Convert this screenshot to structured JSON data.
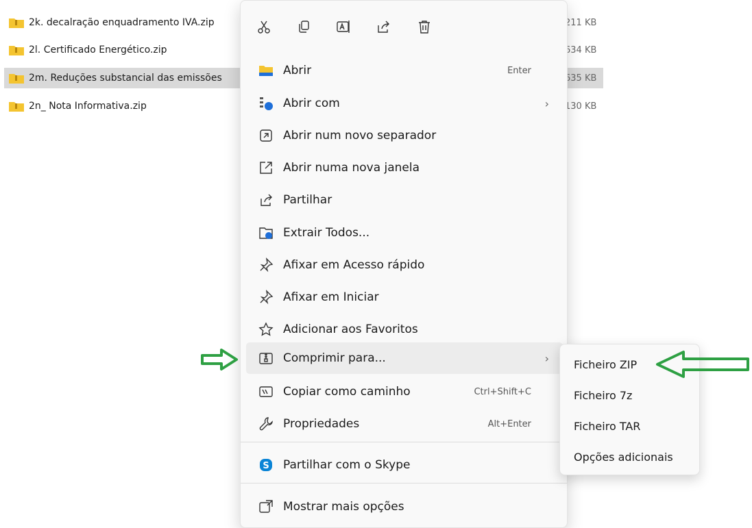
{
  "files": [
    {
      "name": "2k. decalração enquadramento IVA.zip",
      "size": "211 KB",
      "selected": false
    },
    {
      "name": "2l. Certificado Energético.zip",
      "size": "634 KB",
      "selected": false
    },
    {
      "name": "2m. Reduções  substancial das emissões",
      "size": "635 KB",
      "selected": true
    },
    {
      "name": "2n_ Nota Informativa.zip",
      "size": "130 KB",
      "selected": false
    }
  ],
  "context_menu": {
    "quick_actions": [
      "cut-icon",
      "copy-icon",
      "rename-icon",
      "share-icon",
      "delete-icon"
    ],
    "items": [
      {
        "label": "Abrir",
        "shortcut": "Enter",
        "icon": "folder-icon"
      },
      {
        "label": "Abrir com",
        "shortcut": "",
        "icon": "open-with-icon",
        "submenu": true
      },
      {
        "label": "Abrir num novo separador",
        "shortcut": "",
        "icon": "new-tab-icon"
      },
      {
        "label": "Abrir numa nova janela",
        "shortcut": "",
        "icon": "new-window-icon"
      },
      {
        "label": "Partilhar",
        "shortcut": "",
        "icon": "share-icon"
      },
      {
        "label": "Extrair Todos...",
        "shortcut": "",
        "icon": "extract-icon"
      },
      {
        "label": "Afixar em Acesso rápido",
        "shortcut": "",
        "icon": "pin-icon"
      },
      {
        "label": "Afixar em Iniciar",
        "shortcut": "",
        "icon": "pin-icon"
      },
      {
        "label": "Adicionar aos Favoritos",
        "shortcut": "",
        "icon": "star-icon"
      },
      {
        "label": "Comprimir para...",
        "shortcut": "",
        "icon": "compress-icon",
        "submenu": true
      },
      {
        "label": "Copiar como caminho",
        "shortcut": "Ctrl+Shift+C",
        "icon": "copy-path-icon"
      },
      {
        "label": "Propriedades",
        "shortcut": "Alt+Enter",
        "icon": "wrench-icon"
      },
      {
        "label": "Partilhar com o Skype",
        "shortcut": "",
        "icon": "skype-icon"
      },
      {
        "label": "Mostrar mais opções",
        "shortcut": "",
        "icon": "more-options-icon"
      }
    ]
  },
  "submenu": {
    "items": [
      "Ficheiro ZIP",
      "Ficheiro 7z",
      "Ficheiro TAR",
      "Opções adicionais"
    ]
  },
  "colors": {
    "arrow": "#2ea043",
    "selection": "#d9d9d9",
    "skype": "#0a84d6",
    "folder": "#f4c430"
  }
}
